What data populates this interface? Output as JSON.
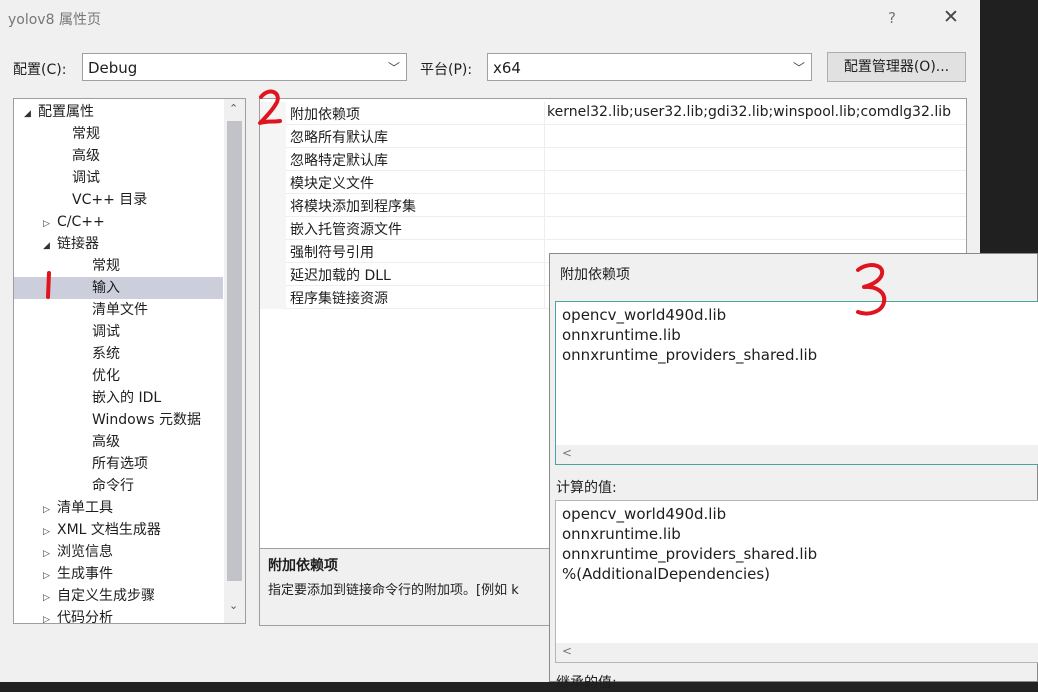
{
  "window": {
    "title": "yolov8 属性页",
    "help": "?",
    "close": "✕"
  },
  "toolbar": {
    "config_label": "配置(C):",
    "config_value": "Debug",
    "platform_label": "平台(P):",
    "platform_value": "x64",
    "config_manager_button": "配置管理器(O)..."
  },
  "tree": {
    "items": [
      {
        "label": "配置属性",
        "expander": "◢"
      },
      {
        "label": "常规",
        "expander": ""
      },
      {
        "label": "高级",
        "expander": ""
      },
      {
        "label": "调试",
        "expander": ""
      },
      {
        "label": "VC++ 目录",
        "expander": ""
      },
      {
        "label": "C/C++",
        "expander": "▷"
      },
      {
        "label": "链接器",
        "expander": "◢"
      },
      {
        "label": "常规",
        "expander": ""
      },
      {
        "label": "输入",
        "expander": ""
      },
      {
        "label": "清单文件",
        "expander": ""
      },
      {
        "label": "调试",
        "expander": ""
      },
      {
        "label": "系统",
        "expander": ""
      },
      {
        "label": "优化",
        "expander": ""
      },
      {
        "label": "嵌入的 IDL",
        "expander": ""
      },
      {
        "label": "Windows 元数据",
        "expander": ""
      },
      {
        "label": "高级",
        "expander": ""
      },
      {
        "label": "所有选项",
        "expander": ""
      },
      {
        "label": "命令行",
        "expander": ""
      },
      {
        "label": "清单工具",
        "expander": "▷"
      },
      {
        "label": "XML 文档生成器",
        "expander": "▷"
      },
      {
        "label": "浏览信息",
        "expander": "▷"
      },
      {
        "label": "生成事件",
        "expander": "▷"
      },
      {
        "label": "自定义生成步骤",
        "expander": "▷"
      },
      {
        "label": "代码分析",
        "expander": "▷"
      }
    ],
    "scroll_up": "⌃",
    "scroll_down": "⌄"
  },
  "properties": {
    "rows": [
      {
        "name": "附加依赖项",
        "value": "kernel32.lib;user32.lib;gdi32.lib;winspool.lib;comdlg32.lib"
      },
      {
        "name": "忽略所有默认库",
        "value": ""
      },
      {
        "name": "忽略特定默认库",
        "value": ""
      },
      {
        "name": "模块定义文件",
        "value": ""
      },
      {
        "name": "将模块添加到程序集",
        "value": ""
      },
      {
        "name": "嵌入托管资源文件",
        "value": ""
      },
      {
        "name": "强制符号引用",
        "value": ""
      },
      {
        "name": "延迟加载的 DLL",
        "value": ""
      },
      {
        "name": "程序集链接资源",
        "value": ""
      }
    ]
  },
  "description": {
    "title": "附加依赖项",
    "text": "指定要添加到链接命令行的附加项。[例如 k"
  },
  "dialog": {
    "title": "附加依赖项",
    "edit_lines": [
      "opencv_world490d.lib",
      "onnxruntime.lib",
      "onnxruntime_providers_shared.lib"
    ],
    "hscroll_left": "<",
    "computed_label": "计算的值:",
    "computed_lines": [
      "opencv_world490d.lib",
      "onnxruntime.lib",
      "onnxruntime_providers_shared.lib",
      "%(AdditionalDependencies)"
    ],
    "inherited_label": "继承的值:"
  }
}
